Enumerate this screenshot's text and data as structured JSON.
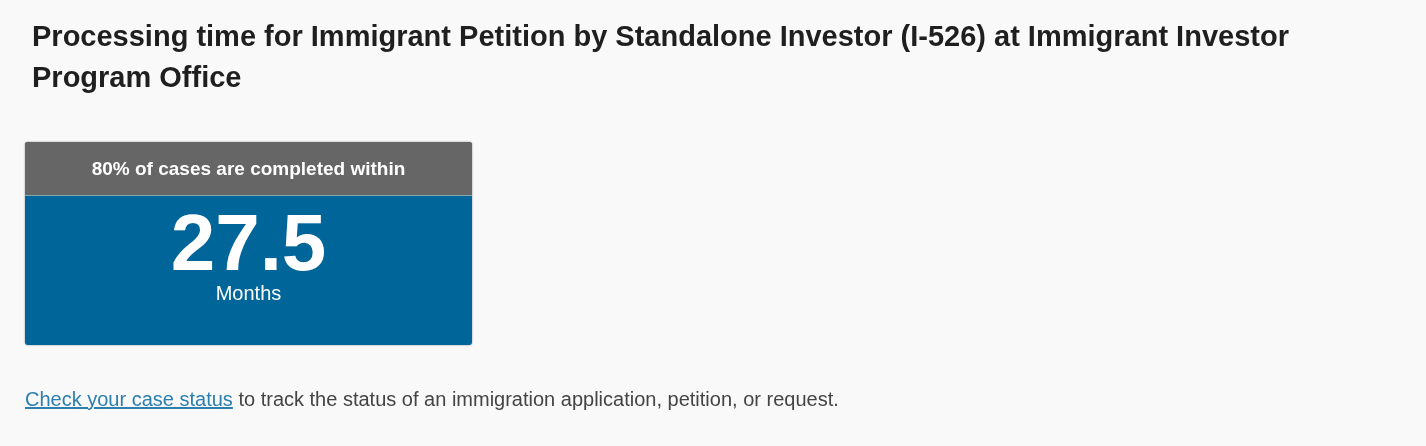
{
  "title": "Processing time for Immigrant Petition by Standalone Investor (I-526) at Immigrant Investor Program Office",
  "result_card": {
    "header": "80% of cases are completed within",
    "value": "27.5",
    "unit": "Months"
  },
  "footer": {
    "link": "Check your case status",
    "text": " to track the status of an immigration application, petition, or request."
  }
}
